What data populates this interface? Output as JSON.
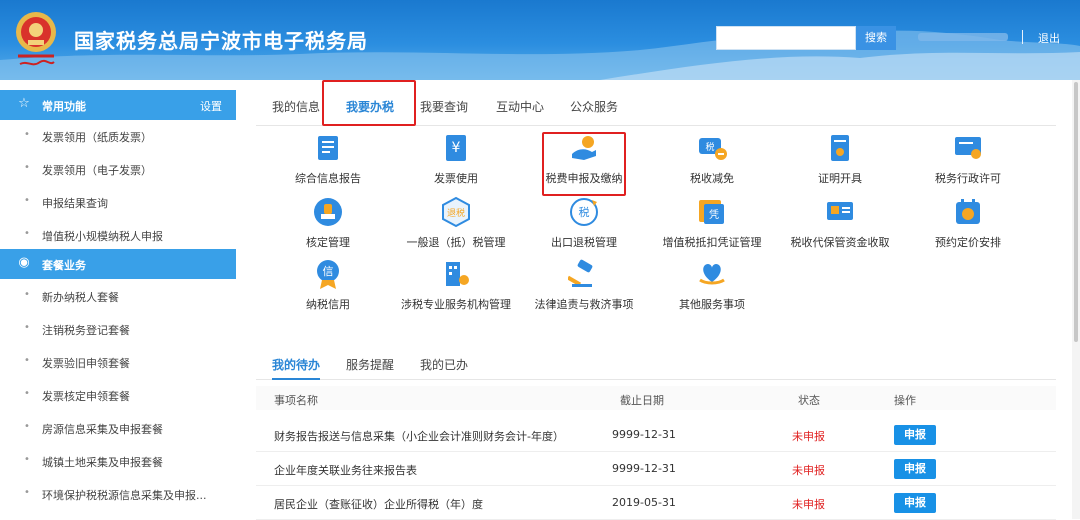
{
  "header": {
    "title": "国家税务总局宁波市电子税务局",
    "search_button": "搜索",
    "logout": "退出",
    "separator": "|"
  },
  "sidebar": {
    "section1": {
      "icon": "star-icon",
      "label": "常用功能",
      "action": "设置"
    },
    "items1": [
      {
        "label": "发票领用（纸质发票）"
      },
      {
        "label": "发票领用（电子发票）"
      },
      {
        "label": "申报结果查询"
      },
      {
        "label": "增值税小规模纳税人申报"
      }
    ],
    "section2": {
      "icon": "package-icon",
      "label": "套餐业务"
    },
    "items2": [
      {
        "label": "新办纳税人套餐"
      },
      {
        "label": "注销税务登记套餐"
      },
      {
        "label": "发票验旧申领套餐"
      },
      {
        "label": "发票核定申领套餐"
      },
      {
        "label": "房源信息采集及申报套餐"
      },
      {
        "label": "城镇土地采集及申报套餐"
      },
      {
        "label": "环境保护税税源信息采集及申报..."
      }
    ]
  },
  "top_tabs": [
    {
      "label": "我的信息"
    },
    {
      "label": "我要办税"
    },
    {
      "label": "我要查询"
    },
    {
      "label": "互动中心"
    },
    {
      "label": "公众服务"
    }
  ],
  "grid": [
    {
      "label": "综合信息报告",
      "icon": "report-icon"
    },
    {
      "label": "发票使用",
      "icon": "invoice-icon"
    },
    {
      "label": "税费申报及缴纳",
      "icon": "tax-payment-icon"
    },
    {
      "label": "税收减免",
      "icon": "tax-reduction-icon"
    },
    {
      "label": "证明开具",
      "icon": "certificate-icon"
    },
    {
      "label": "税务行政许可",
      "icon": "license-icon"
    },
    {
      "label": "核定管理",
      "icon": "stamp-icon"
    },
    {
      "label": "一般退（抵）税管理",
      "icon": "refund-icon"
    },
    {
      "label": "出口退税管理",
      "icon": "export-refund-icon"
    },
    {
      "label": "增值税抵扣凭证管理",
      "icon": "voucher-icon"
    },
    {
      "label": "税收代保管资金收取",
      "icon": "custody-funds-icon"
    },
    {
      "label": "预约定价安排",
      "icon": "pricing-icon"
    },
    {
      "label": "纳税信用",
      "icon": "credit-medal-icon"
    },
    {
      "label": "涉税专业服务机构管理",
      "icon": "building-icon"
    },
    {
      "label": "法律追责与救济事项",
      "icon": "gavel-icon"
    },
    {
      "label": "其他服务事项",
      "icon": "heart-hand-icon"
    }
  ],
  "bottom_tabs": [
    {
      "label": "我的待办"
    },
    {
      "label": "服务提醒"
    },
    {
      "label": "我的已办"
    }
  ],
  "table": {
    "headers": {
      "name": "事项名称",
      "date": "截止日期",
      "status": "状态",
      "action": "操作"
    },
    "rows": [
      {
        "name": "财务报告报送与信息采集（小企业会计准则财务会计-年度）",
        "date": "9999-12-31",
        "status": "未申报",
        "action": "申报"
      },
      {
        "name": "企业年度关联业务往来报告表",
        "date": "9999-12-31",
        "status": "未申报",
        "action": "申报"
      },
      {
        "name": "居民企业（查账征收）企业所得税（年）度",
        "date": "2019-05-31",
        "status": "未申报",
        "action": "申报"
      }
    ]
  },
  "colors": {
    "brand_blue": "#2a86d6",
    "sidebar_header": "#39a0e8",
    "alert_red": "#e02020",
    "button_blue": "#1891e6"
  }
}
